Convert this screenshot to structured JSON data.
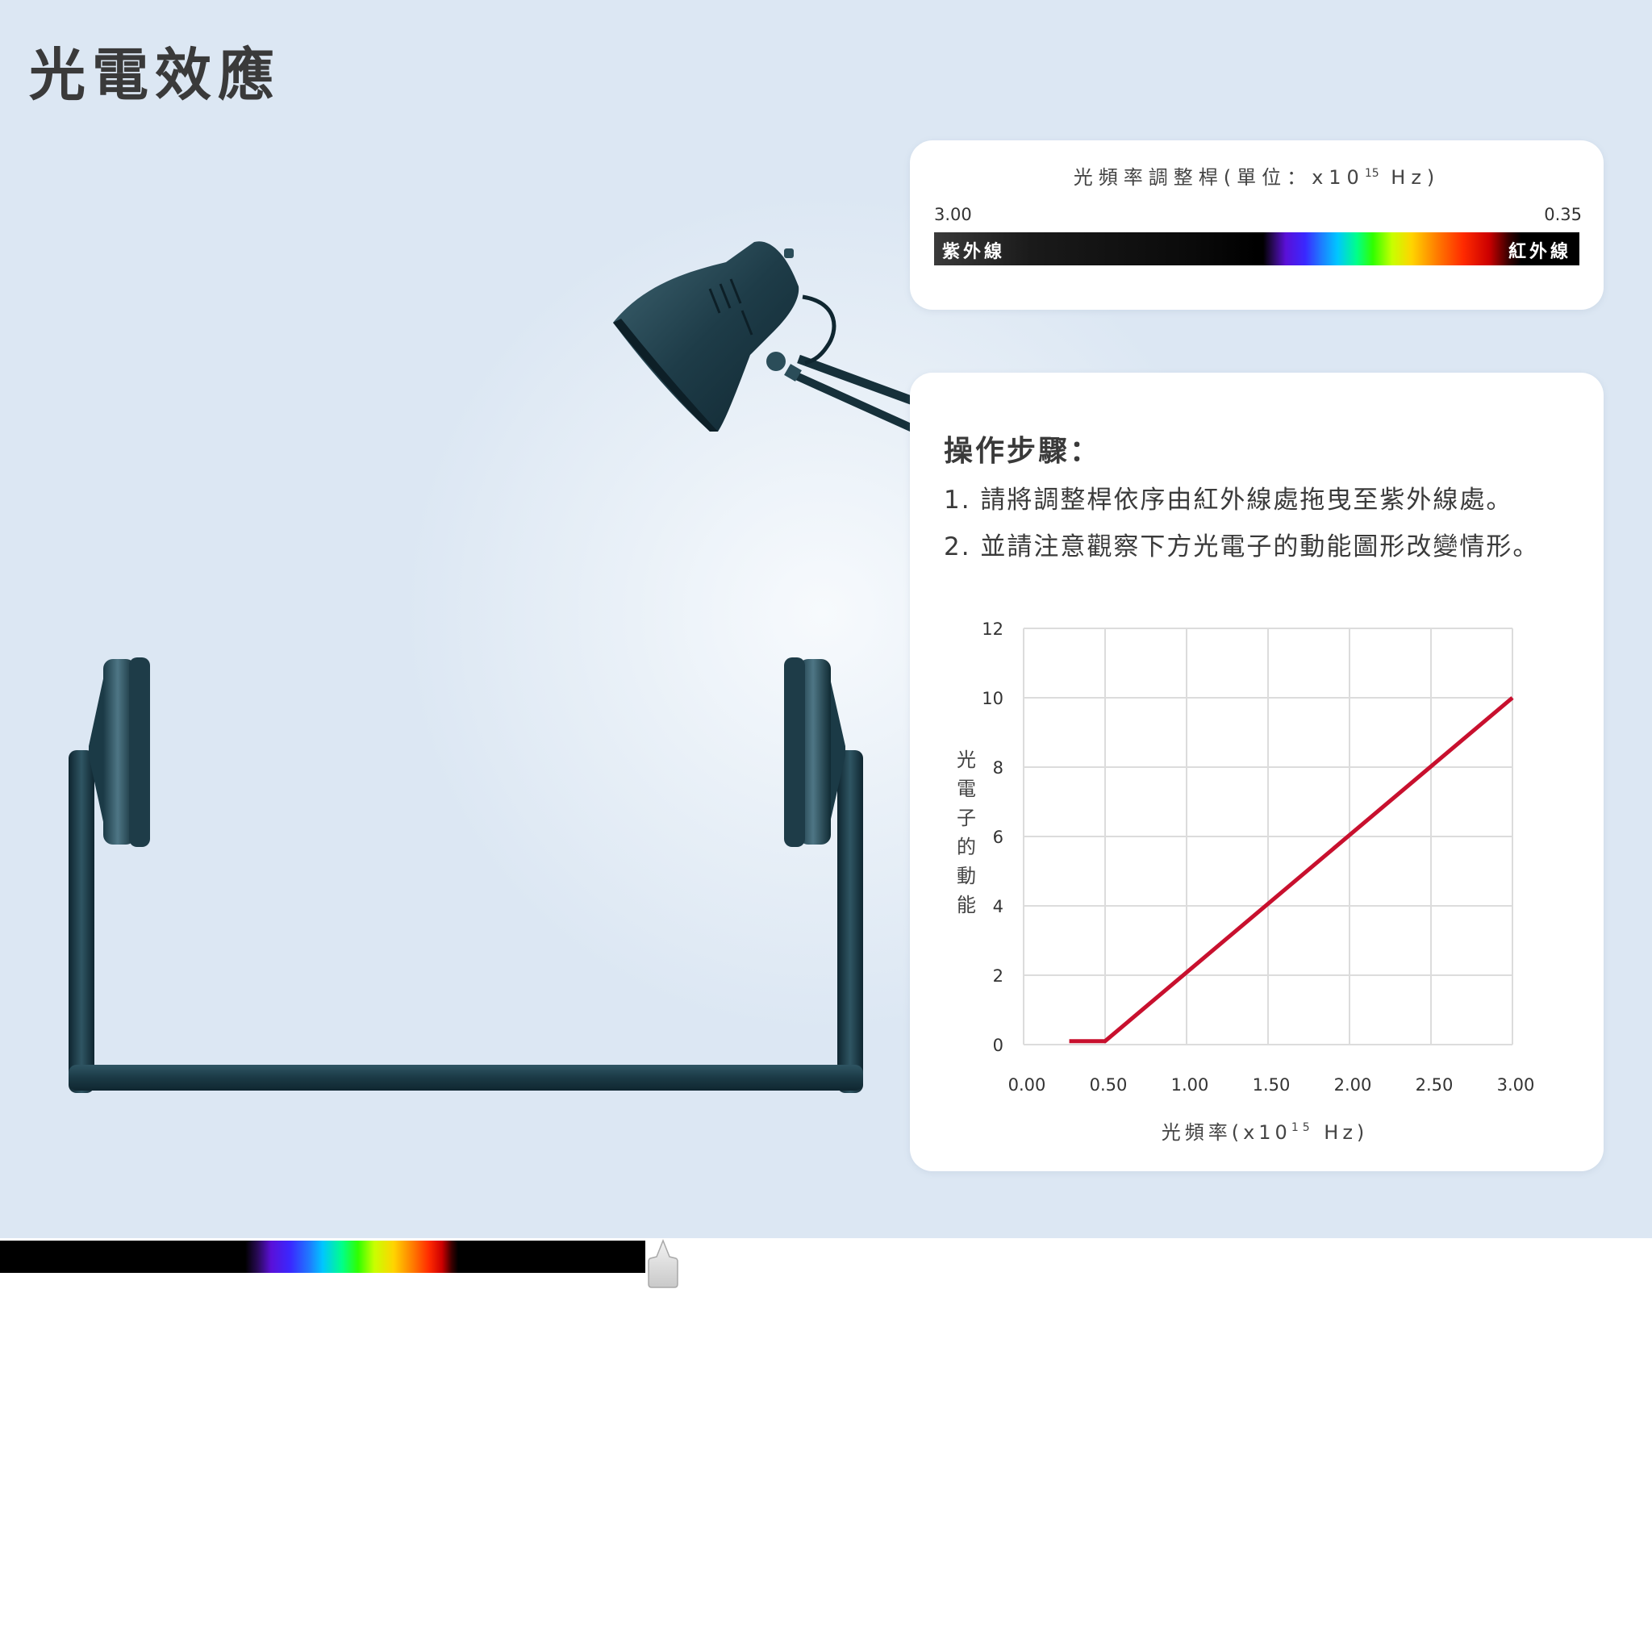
{
  "page": {
    "title": "光電效應"
  },
  "frequency_slider": {
    "title_prefix": "光頻率調整桿(單位：x10",
    "title_exp": "15",
    "title_suffix": " Hz)",
    "min_label": "3.00",
    "max_label": "0.35",
    "left_band": "紫外線",
    "right_band": "紅外線"
  },
  "instructions": {
    "heading": "操作步驟：",
    "steps": [
      "1. 請將調整桿依序由紅外線處拖曳至紫外線處。",
      "2. 並請注意觀察下方光電子的動能圖形改變情形。"
    ]
  },
  "chart_data": {
    "type": "line",
    "xlabel_prefix": "光頻率(x10",
    "xlabel_exp": "15",
    "xlabel_suffix": " Hz)",
    "ylabel": "光電子的動能",
    "x_ticks": [
      "0.00",
      "0.50",
      "1.00",
      "1.50",
      "2.00",
      "2.50",
      "3.00"
    ],
    "y_ticks": [
      "0",
      "2",
      "4",
      "6",
      "8",
      "10",
      "12"
    ],
    "xlim": [
      0,
      3
    ],
    "ylim": [
      0,
      12
    ],
    "grid": true,
    "series": [
      {
        "color": "#c8102e",
        "x": [
          0.28,
          0.5,
          3.0
        ],
        "y": [
          0.1,
          0.1,
          10
        ]
      }
    ]
  },
  "colors": {
    "series": "#c8102e",
    "apparatus": "#1e3c48",
    "title": "#3a3a3a"
  },
  "icons": {
    "lamp": "desk-lamp-icon",
    "electrodes": "electrode-plates-icon",
    "handle": "slider-handle-icon"
  }
}
